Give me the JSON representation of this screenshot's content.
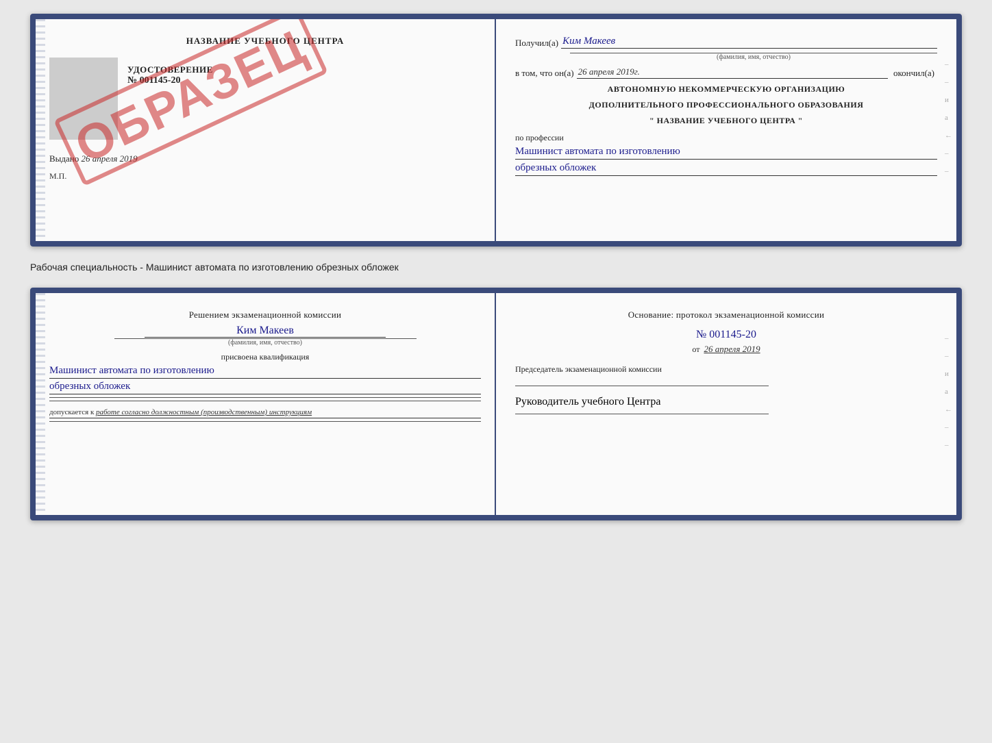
{
  "top_left": {
    "title": "НАЗВАНИЕ УЧЕБНОГО ЦЕНТРА",
    "stamp": "ОБРАЗЕЦ",
    "udost_label": "УДОСТОВЕРЕНИЕ",
    "udost_number": "№ 001145-20",
    "vydano_label": "Выдано",
    "vydano_date": "26 апреля 2019",
    "mp": "М.П."
  },
  "top_right": {
    "poluchil_label": "Получил(а)",
    "poluchil_value": "Ким Макеев",
    "fam_placeholder": "(фамилия, имя, отчество)",
    "vtom_label": "в том, что он(а)",
    "date_value": "26 апреля 2019г.",
    "okonchil_label": "окончил(а)",
    "org_line1": "АВТОНОМНУЮ НЕКОММЕРЧЕСКУЮ ОРГАНИЗАЦИЮ",
    "org_line2": "ДОПОЛНИТЕЛЬНОГО ПРОФЕССИОНАЛЬНОГО ОБРАЗОВАНИЯ",
    "org_line3": "\"  НАЗВАНИЕ УЧЕБНОГО ЦЕНТРА  \"",
    "po_professii": "по профессии",
    "profession1": "Машинист автомата по изготовлению",
    "profession2": "обрезных обложек",
    "right_marks": [
      "-",
      "-",
      "-",
      "и",
      "а",
      "←",
      "-",
      "-",
      "-",
      "-"
    ]
  },
  "caption": "Рабочая специальность - Машинист автомата по изготовлению обрезных обложек",
  "bottom_left": {
    "resheniem": "Решением экзаменационной комиссии",
    "fio": "Ким Макеев",
    "fam_placeholder": "(фамилия, имя, отчество)",
    "prisvoena": "присвоена квалификация",
    "kvalif1": "Машинист автомата по изготовлению",
    "kvalif2": "обрезных обложек",
    "dopuskaet_label": "допускается к",
    "dopuskaet_value": "работе согласно должностным (производственным) инструкциям"
  },
  "bottom_right": {
    "osnovanie": "Основание: протокол экзаменационной комиссии",
    "number": "№  001145-20",
    "ot_label": "от",
    "ot_date": "26 апреля 2019",
    "predsed_label": "Председатель экзаменационной комиссии",
    "rukav_label": "Руководитель учебного Центра",
    "right_marks": [
      "-",
      "-",
      "-",
      "и",
      "а",
      "←",
      "-",
      "-",
      "-",
      "-"
    ]
  }
}
